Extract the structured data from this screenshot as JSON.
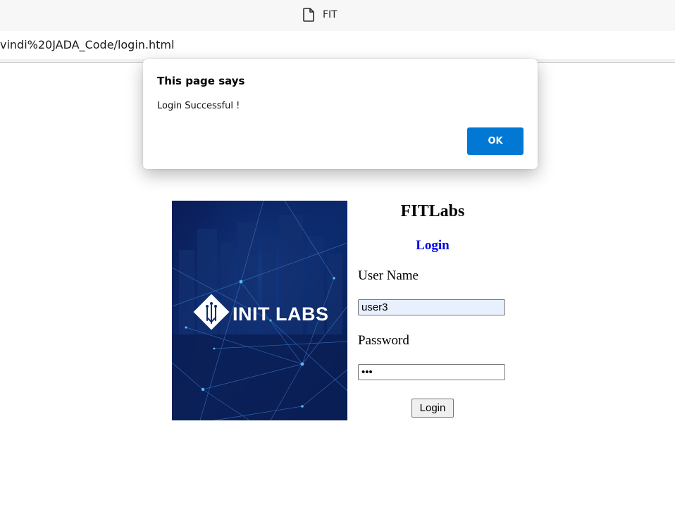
{
  "browser": {
    "tab_title": "FIT",
    "tab_icon": "page-icon",
    "url": "vindi%20JADA_Code/login.html"
  },
  "dialog": {
    "title": "This page says",
    "message": "Login Successful !",
    "ok_label": "OK",
    "ok_color": "#0078d4"
  },
  "page": {
    "site_title": "FITLabs",
    "login_heading": "Login",
    "login_heading_color": "#0000ee",
    "hero_logo_text": "INIT LABS",
    "username_label": "User Name",
    "username_value": "user3",
    "password_label": "Password",
    "password_value": "•••",
    "login_button_label": "Login"
  }
}
